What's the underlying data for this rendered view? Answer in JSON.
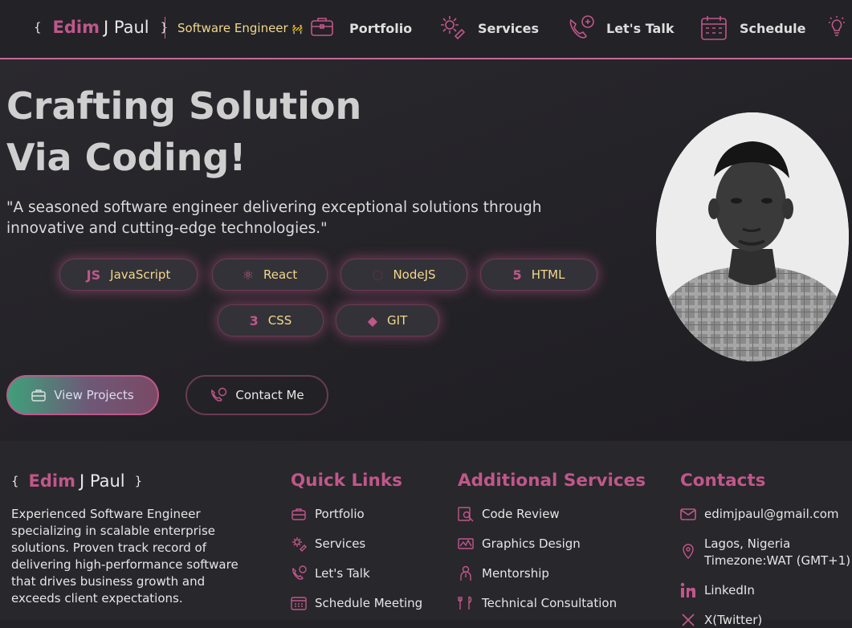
{
  "header": {
    "brand_open": "{",
    "brand_first": "Edim",
    "brand_rest": "J Paul",
    "brand_close": "}",
    "role": "Software Engineer",
    "role_icon": "construction-cone-emoji",
    "nav": [
      {
        "label": "Portfolio",
        "icon": "briefcase-icon"
      },
      {
        "label": "Services",
        "icon": "gear-icon"
      },
      {
        "label": "Let's Talk",
        "icon": "phone-chat-icon"
      },
      {
        "label": "Schedule",
        "icon": "calendar-icon"
      }
    ],
    "theme_icon": "lightbulb-icon"
  },
  "hero": {
    "headline_line1": "Crafting Solution",
    "headline_line2": "Via Coding!",
    "tagline": "\"A seasoned software engineer delivering exceptional solutions through innovative and cutting-edge technologies.\"",
    "skills": [
      {
        "label": "JavaScript",
        "icon": "js-icon",
        "glyph": "JS"
      },
      {
        "label": "React",
        "icon": "react-icon",
        "glyph": "⚛"
      },
      {
        "label": "NodeJS",
        "icon": "nodejs-icon",
        "glyph": "⬡"
      },
      {
        "label": "HTML",
        "icon": "html5-icon",
        "glyph": "5"
      },
      {
        "label": "CSS",
        "icon": "css3-icon",
        "glyph": "3"
      },
      {
        "label": "GIT",
        "icon": "git-icon",
        "glyph": "◆"
      }
    ],
    "primary_button": "View Projects",
    "secondary_button": "Contact Me"
  },
  "footer": {
    "brand_open": "{",
    "brand_first": "Edim",
    "brand_rest": "J Paul",
    "brand_close": "}",
    "description": "Experienced Software Engineer specializing in scalable enterprise solutions. Proven track record of delivering high-performance software that drives business growth and exceeds client expectations.",
    "quick_links": {
      "title": "Quick Links",
      "items": [
        "Portfolio",
        "Services",
        "Let's Talk",
        "Schedule Meeting"
      ]
    },
    "additional_services": {
      "title": "Additional Services",
      "items": [
        "Code Review",
        "Graphics Design",
        "Mentorship",
        "Technical Consultation"
      ]
    },
    "contacts": {
      "title": "Contacts",
      "email": "edimjpaul@gmail.com",
      "location_line1": "Lagos, Nigeria",
      "location_line2": "Timezone:WAT (GMT+1)",
      "linkedin": "LinkedIn",
      "twitter": "X(Twitter)"
    }
  },
  "colors": {
    "accent": "#c0578a",
    "highlight": "#f2d88a",
    "background": "#242327",
    "footer_background": "#28272c"
  }
}
